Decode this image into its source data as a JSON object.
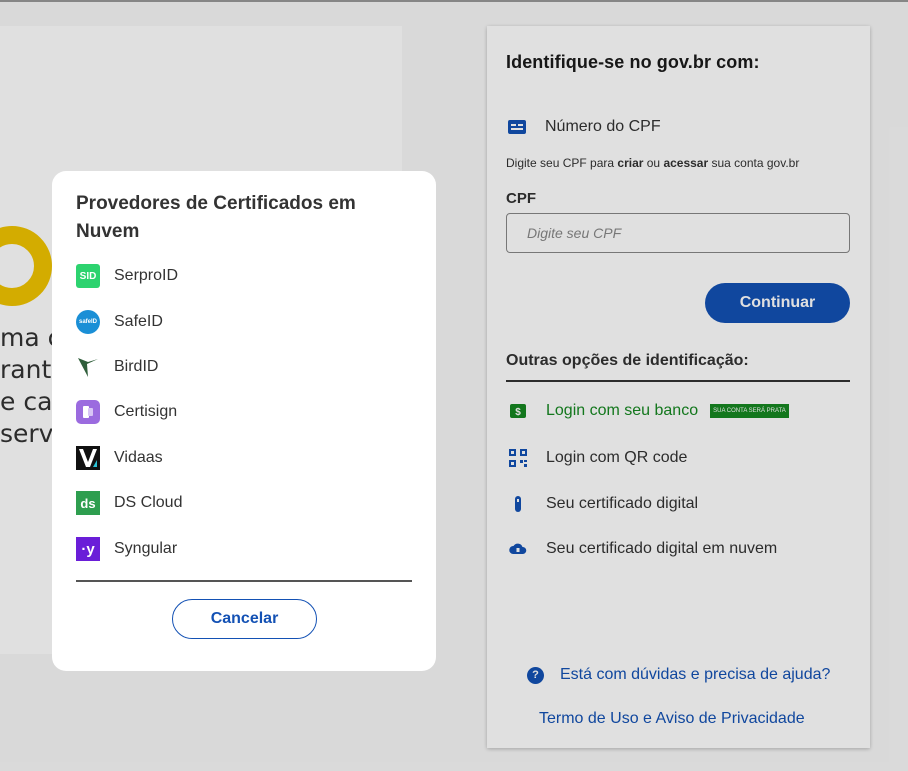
{
  "left": {
    "lines": [
      "ma co",
      "rante",
      "e cad",
      "serv"
    ]
  },
  "panel": {
    "title": "Identifique-se no gov.br com:",
    "cpf_option_label": "Número do CPF",
    "cpf_help_prefix": "Digite seu CPF para ",
    "cpf_help_bold1": "criar",
    "cpf_help_mid": " ou ",
    "cpf_help_bold2": "acessar",
    "cpf_help_suffix": " sua conta gov.br",
    "cpf_field_label": "CPF",
    "cpf_placeholder": "Digite seu CPF",
    "continue_label": "Continuar",
    "other_title": "Outras opções de identificação:",
    "options": [
      {
        "label": "Login com seu banco",
        "icon": "bank-icon",
        "badge": "SUA CONTA SERÁ PRATA"
      },
      {
        "label": "Login com QR code",
        "icon": "qr-code-icon"
      },
      {
        "label": "Seu certificado digital",
        "icon": "usb-token-icon"
      },
      {
        "label": "Seu certificado digital em nuvem",
        "icon": "cloud-certificate-icon"
      }
    ],
    "help_label": "Está com dúvidas e precisa de ajuda?",
    "terms_label": "Termo de Uso e Aviso de Privacidade"
  },
  "modal": {
    "title": "Provedores de Certificados em Nuvem",
    "providers": [
      {
        "label": "SerproID",
        "icon": "serproid-logo",
        "color": "#2dd36f"
      },
      {
        "label": "SafeID",
        "icon": "safeid-logo",
        "color": "#1a8fd6"
      },
      {
        "label": "BirdID",
        "icon": "birdid-logo",
        "color": "#2f5e3a"
      },
      {
        "label": "Certisign",
        "icon": "certisign-logo",
        "color": "#9b6bdf"
      },
      {
        "label": "Vidaas",
        "icon": "vidaas-logo",
        "color": "#111111"
      },
      {
        "label": "DS Cloud",
        "icon": "dscloud-logo",
        "color": "#2e9e4f"
      },
      {
        "label": "Syngular",
        "icon": "syngular-logo",
        "color": "#6a1ed8"
      }
    ],
    "cancel_label": "Cancelar"
  },
  "colors": {
    "primary": "#1351b4",
    "success": "#168821",
    "govbr_yellow": "#f1c400"
  }
}
